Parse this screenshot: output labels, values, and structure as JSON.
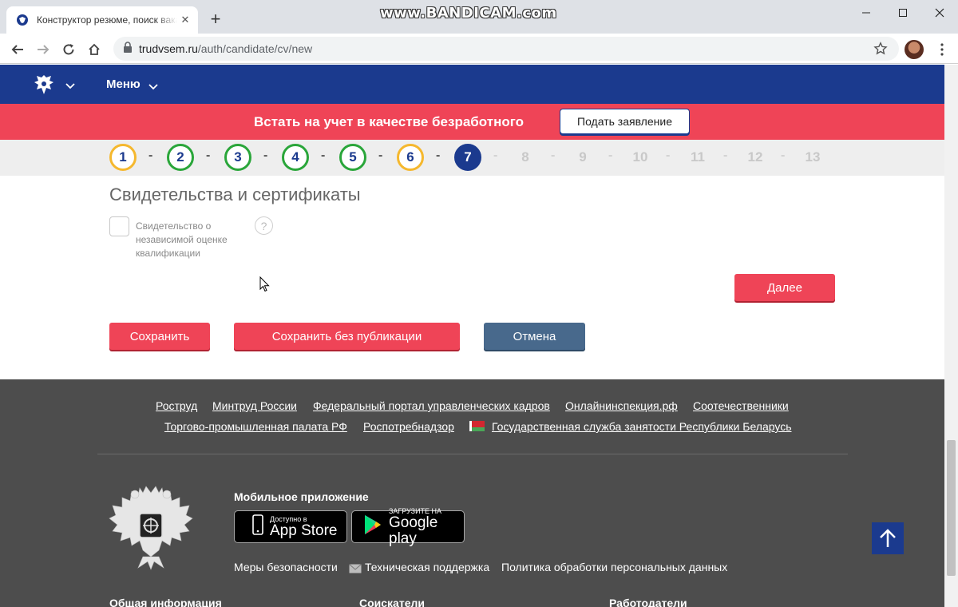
{
  "browser": {
    "tab_title": "Конструктор резюме, поиск вакансий",
    "tab_close": "✕",
    "new_tab": "+",
    "watermark": "www.BANDICAM.com",
    "url_host": "trudvsem.ru",
    "url_path": "/auth/candidate/cv/new"
  },
  "header": {
    "menu_label": "Меню"
  },
  "banner": {
    "text": "Встать на учет в качестве безработного",
    "apply_label": "Подать заявление"
  },
  "steps": {
    "items": [
      "1",
      "2",
      "3",
      "4",
      "5",
      "6",
      "7",
      "8",
      "9",
      "10",
      "11",
      "12",
      "13"
    ],
    "separator": "-",
    "current": "7",
    "colors": {
      "done_ok": "#2aa63a",
      "done_warn": "#f5b82e",
      "active": "#1b3a8e"
    }
  },
  "form": {
    "section_title": "Свидетельства и сертификаты",
    "checkbox_label": "Свидетельство о независимой оценке квалификации",
    "help": "?",
    "next_label": "Далее",
    "save_label": "Сохранить",
    "save_draft_label": "Сохранить без публикации",
    "cancel_label": "Отмена"
  },
  "footer": {
    "links_row1": [
      "Роструд",
      "Минтруд России",
      "Федеральный портал управленческих кадров",
      "Онлайнинспекция.рф",
      "Соотечественники"
    ],
    "links_row2": [
      "Торгово-промышленная палата РФ",
      "Роспотребнадзор",
      "Государственная служба занятости Республики Беларусь"
    ],
    "mobile_title": "Мобильное приложение",
    "appstore_small": "Доступно в",
    "appstore_big": "App Store",
    "googleplay_small": "ЗАГРУЗИТЕ НА",
    "googleplay_big": "Google play",
    "security_label": "Меры безопасности",
    "support_label": "Техническая поддержка",
    "privacy_label": "Политика обработки персональных данных",
    "col_general": "Общая информация",
    "col_seekers": "Соискатели",
    "col_employers": "Работодатели"
  },
  "colors": {
    "brand_blue": "#1b3a8e",
    "brand_red": "#ef4457",
    "footer_bg": "#4d4d4d",
    "cancel_btn": "#48698c"
  }
}
